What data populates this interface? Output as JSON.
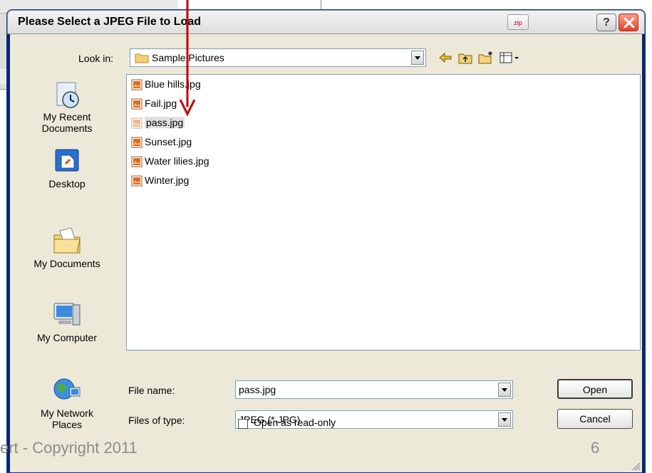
{
  "dialog": {
    "title": "Please Select a JPEG File to Load",
    "zip_label": "zip",
    "help_label": "?"
  },
  "look_in": {
    "label": "Look in:",
    "value": "Sample Pictures"
  },
  "places": [
    {
      "label": "My Recent\nDocuments",
      "icon": "recent-documents-icon"
    },
    {
      "label": "Desktop",
      "icon": "desktop-icon"
    },
    {
      "label": "My Documents",
      "icon": "my-documents-icon"
    },
    {
      "label": "My Computer",
      "icon": "my-computer-icon"
    },
    {
      "label": "My Network\nPlaces",
      "icon": "network-places-icon"
    }
  ],
  "files": [
    {
      "name": "Blue hills.jpg",
      "selected": false
    },
    {
      "name": "Fail.jpg",
      "selected": false
    },
    {
      "name": "pass.jpg",
      "selected": true
    },
    {
      "name": "Sunset.jpg",
      "selected": false
    },
    {
      "name": "Water lilies.jpg",
      "selected": false
    },
    {
      "name": "Winter.jpg",
      "selected": false
    }
  ],
  "file_name": {
    "label": "File name:",
    "value": "pass.jpg"
  },
  "file_type": {
    "label": "Files of type:",
    "value": "JPEG (*.JPG)"
  },
  "read_only": {
    "label": "Open as read-only",
    "checked": false
  },
  "buttons": {
    "open": "Open",
    "cancel": "Cancel"
  },
  "footer": {
    "left": "ert - Copyright 2011",
    "right": "6"
  },
  "colors": {
    "arrow": "#c00000",
    "title_bar": "#e6e6e6",
    "dialog_body": "#ece9d8"
  }
}
